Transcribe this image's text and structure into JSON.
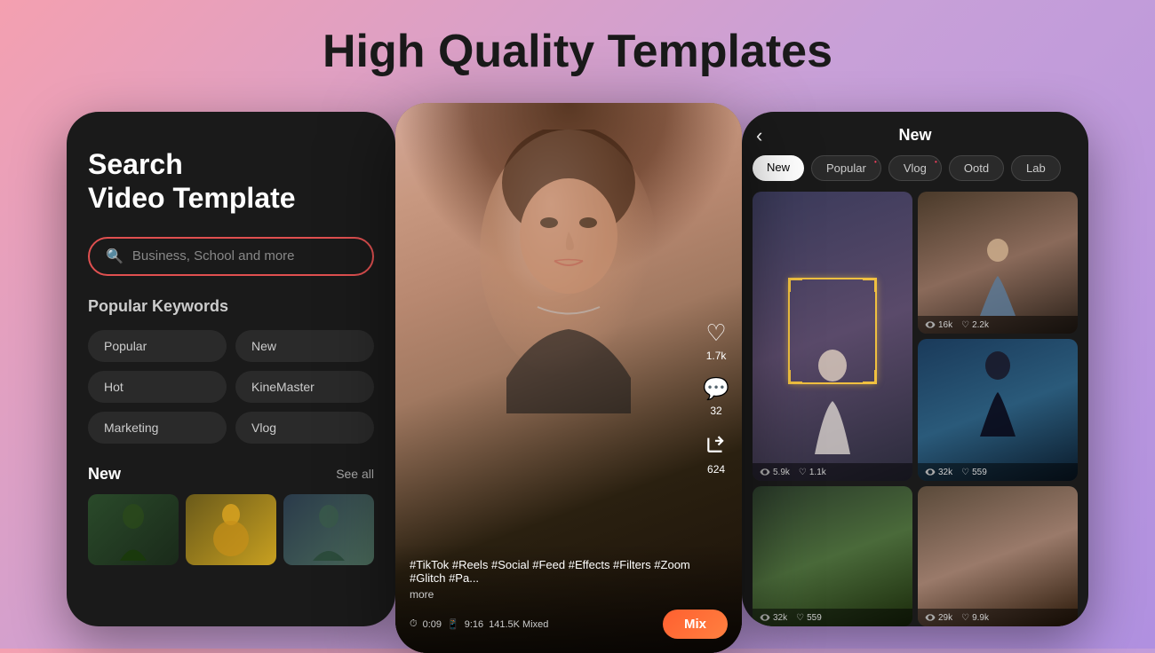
{
  "page": {
    "title": "High Quality Templates",
    "bg_gradient": "linear-gradient(135deg, #f4a0b0, #c8a0d8, #b090e0)"
  },
  "phone_search": {
    "title_line1": "Search",
    "title_line2": "Video Template",
    "search_placeholder": "Business, School and more",
    "popular_keywords_label": "Popular Keywords",
    "keywords": [
      {
        "label": "Popular"
      },
      {
        "label": "New"
      },
      {
        "label": "Hot"
      },
      {
        "label": "KineMaster"
      },
      {
        "label": "Marketing"
      },
      {
        "label": "Vlog"
      }
    ],
    "new_section_label": "New",
    "see_all_label": "See all"
  },
  "phone_video": {
    "actions": [
      {
        "icon": "♡",
        "count": "1.7k"
      },
      {
        "icon": "💬",
        "count": "32"
      },
      {
        "icon": "↗",
        "count": "624"
      }
    ],
    "tags": "#TikTok #Reels #Social #Feed #Effects #Filters #Zoom #Glitch #Pa...",
    "more_label": "more",
    "duration": "0:09",
    "ratio": "9:16",
    "views": "141.5K Mixed",
    "mix_label": "Mix"
  },
  "phone_grid": {
    "back_icon": "‹",
    "title": "New",
    "tabs": [
      {
        "label": "New",
        "active": true
      },
      {
        "label": "Popular",
        "dot": true
      },
      {
        "label": "Vlog",
        "dot": true
      },
      {
        "label": "Ootd"
      },
      {
        "label": "Lab"
      }
    ],
    "items": [
      {
        "views": "5.9k",
        "likes": "1.1k"
      },
      {
        "views": "16k",
        "likes": "2.2k"
      },
      {
        "views": "32k",
        "likes": "559"
      },
      {
        "views": "29k",
        "likes": "9.9k"
      }
    ]
  }
}
